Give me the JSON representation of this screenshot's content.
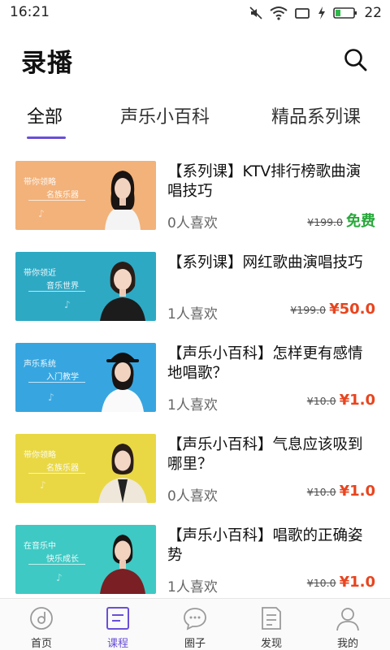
{
  "status_bar": {
    "time": "16:21",
    "battery": "22"
  },
  "header": {
    "title": "录播",
    "search_icon": "search-icon"
  },
  "tabs": [
    {
      "label": "全部",
      "active": true
    },
    {
      "label": "声乐小百科",
      "active": false
    },
    {
      "label": "精品系列课",
      "active": false
    }
  ],
  "courses": [
    {
      "title": "【系列课】KTV排行榜歌曲演唱技巧",
      "likes": "0人喜欢",
      "old_price": "¥199.0",
      "price": "免费",
      "thumb_line1": "带你领略",
      "thumb_line2": "名族乐器",
      "thumb_color": "#f2b27a"
    },
    {
      "title": "【系列课】网红歌曲演唱技巧",
      "likes": "1人喜欢",
      "old_price": "¥199.0",
      "price": "¥50.0",
      "thumb_line1": "带你领近",
      "thumb_line2": "音乐世界",
      "thumb_color": "#2ea9c4"
    },
    {
      "title": "【声乐小百科】怎样更有感情地唱歌？",
      "likes": "1人喜欢",
      "old_price": "¥10.0",
      "price": "¥1.0",
      "thumb_line1": "声乐系统",
      "thumb_line2": "入门教学",
      "thumb_color": "#37a6e0"
    },
    {
      "title": "【声乐小百科】气息应该吸到哪里？",
      "likes": "0人喜欢",
      "old_price": "¥10.0",
      "price": "¥1.0",
      "thumb_line1": "带你领略",
      "thumb_line2": "名族乐器",
      "thumb_color": "#e9d844"
    },
    {
      "title": "【声乐小百科】唱歌的正确姿势",
      "likes": "1人喜欢",
      "old_price": "¥10.0",
      "price": "¥1.0",
      "thumb_line1": "在音乐中",
      "thumb_line2": "快乐成长",
      "thumb_color": "#3ec9c4"
    }
  ],
  "bottom_nav": [
    {
      "label": "首页",
      "icon": "home-disc-icon",
      "active": false
    },
    {
      "label": "课程",
      "icon": "course-list-icon",
      "active": true
    },
    {
      "label": "圈子",
      "icon": "chat-bubble-icon",
      "active": false
    },
    {
      "label": "发现",
      "icon": "discover-doc-icon",
      "active": false
    },
    {
      "label": "我的",
      "icon": "profile-icon",
      "active": false
    }
  ],
  "colors": {
    "accent": "#6a4fd8",
    "price": "#e8451f",
    "free": "#27a83a"
  }
}
